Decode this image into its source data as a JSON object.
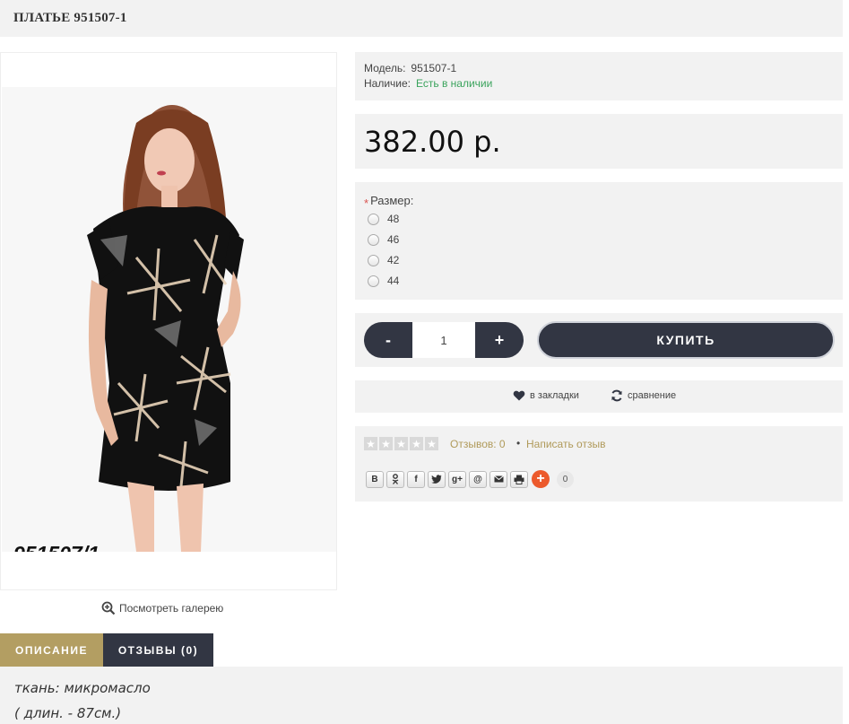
{
  "product": {
    "title": "ПЛАТЬЕ 951507-1",
    "photo_caption": "951507/1",
    "gallery_link": "Посмотреть галерею"
  },
  "meta": {
    "model_label": "Модель:",
    "model_value": "951507-1",
    "stock_label": "Наличие:",
    "stock_value": "Есть в наличии",
    "stock_color": "#3aa35c"
  },
  "price": "382.00 р.",
  "options": {
    "label": "Размер:",
    "required_mark": "*",
    "sizes": [
      "48",
      "46",
      "42",
      "44"
    ]
  },
  "cart": {
    "minus": "-",
    "plus": "+",
    "quantity": "1",
    "buy_label": "КУПИТЬ"
  },
  "links": {
    "wishlist": "в закладки",
    "compare": "сравнение"
  },
  "reviews": {
    "rating": 0,
    "count_label": "Отзывов: 0",
    "separator": "•",
    "write_label": "Написать отзыв",
    "link_color": "#b09a5a"
  },
  "share": {
    "buttons": [
      "В",
      "ok",
      "f",
      "twitter",
      "g+",
      "@",
      "mail",
      "print"
    ],
    "count": "0"
  },
  "tabs": {
    "description": "ОПИСАНИЕ",
    "reviews": "ОТЗЫВЫ (0)"
  },
  "description": {
    "line1": "ткань: микромасло",
    "line2": "( длин. - 87см.)"
  },
  "colors": {
    "dark": "#323643",
    "gold": "#b39e62",
    "panel_bg": "#f2f2f2"
  }
}
